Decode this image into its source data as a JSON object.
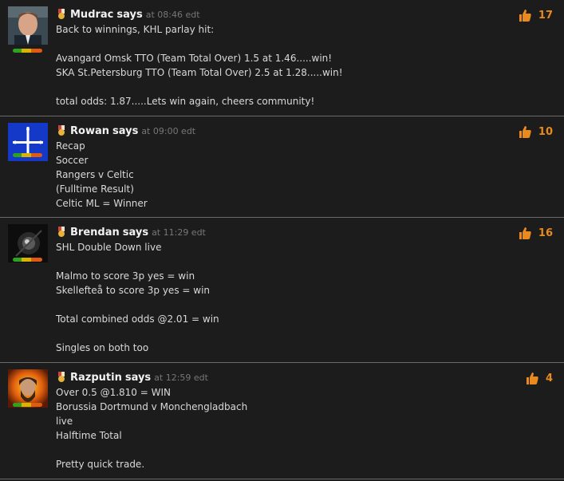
{
  "comments": [
    {
      "author": "Mudrac",
      "says": "says",
      "time": "at 08:46 edt",
      "likes": "17",
      "body": "Back to winnings, KHL parlay hit:\n\nAvangard Omsk TTO (Team Total Over) 1.5 at 1.46.....win!\nSKA St.Petersburg TTO (Team Total Over) 2.5 at 1.28.....win!\n\ntotal odds: 1.87.....Lets win again, cheers community!"
    },
    {
      "author": "Rowan",
      "says": "says",
      "time": "at 09:00 edt",
      "likes": "10",
      "body": "Recap\nSoccer\nRangers v Celtic\n(Fulltime Result)\nCeltic ML = Winner"
    },
    {
      "author": "Brendan",
      "says": "says",
      "time": "at 11:29 edt",
      "likes": "16",
      "body": "SHL Double Down live\n\nMalmo to score 3p yes = win\nSkellefteå to score 3p yes = win\n\nTotal combined odds @2.01 = win\n\nSingles on both too"
    },
    {
      "author": "Razputin",
      "says": "says",
      "time": "at 12:59 edt",
      "likes": "4",
      "body": "Over 0.5 @1.810 = WIN\nBorussia Dortmund v Monchengladbach\nlive\nHalftime Total\n\nPretty quick trade."
    }
  ],
  "colors": {
    "background": "#1c1c1c",
    "likes": "#e88a1d",
    "divider": "#6a6a6a"
  }
}
